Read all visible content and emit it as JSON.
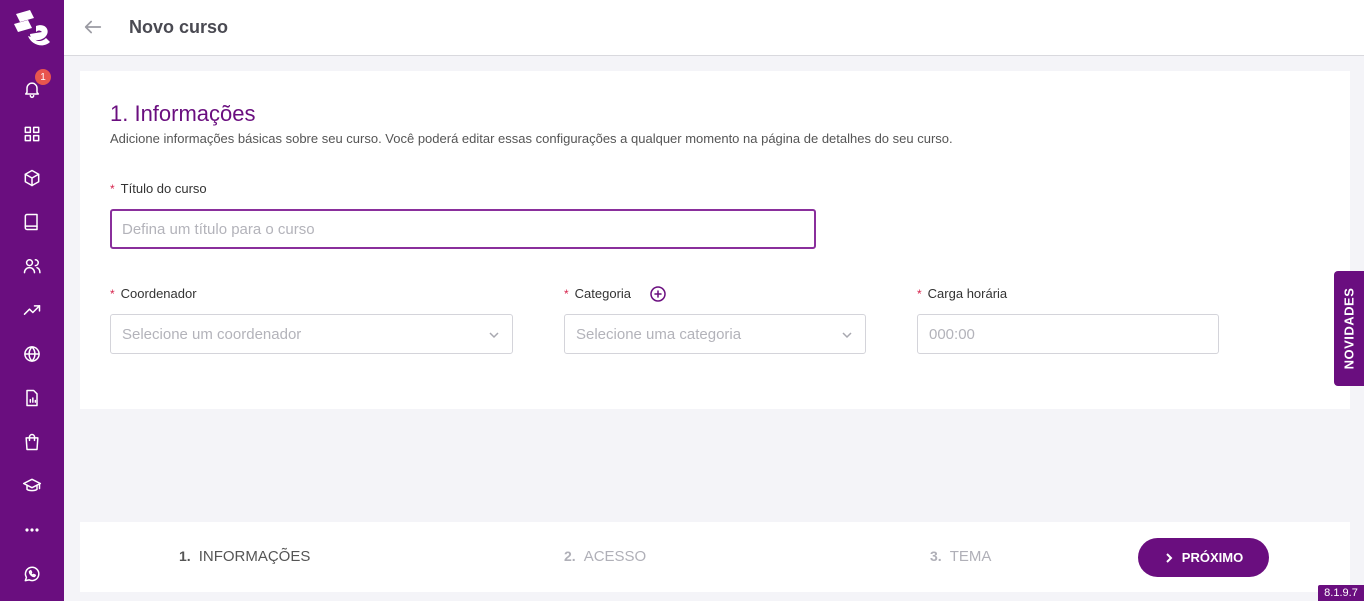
{
  "header": {
    "title": "Novo curso"
  },
  "sidebar": {
    "notification_count": "1"
  },
  "section": {
    "title": "1. Informações",
    "description": "Adicione informações básicas sobre seu curso. Você poderá editar essas configurações a qualquer momento na página de detalhes do seu curso."
  },
  "form": {
    "title_label": "Título do curso",
    "title_placeholder": "Defina um título para o curso",
    "coordinator_label": "Coordenador",
    "coordinator_placeholder": "Selecione um coordenador",
    "category_label": "Categoria",
    "category_placeholder": "Selecione uma categoria",
    "workload_label": "Carga horária",
    "workload_placeholder": "000:00",
    "required_mark": "*"
  },
  "steps": [
    {
      "num": "1.",
      "label": "INFORMAÇÕES"
    },
    {
      "num": "2.",
      "label": "ACESSO"
    },
    {
      "num": "3.",
      "label": "TEMA"
    }
  ],
  "footer": {
    "next_label": "PRÓXIMO"
  },
  "novidades_label": "NOVIDADES",
  "version": "8.1.9.7",
  "colors": {
    "brand": "#6a0e7f",
    "required": "#d6244d",
    "badge": "#e8554e"
  }
}
